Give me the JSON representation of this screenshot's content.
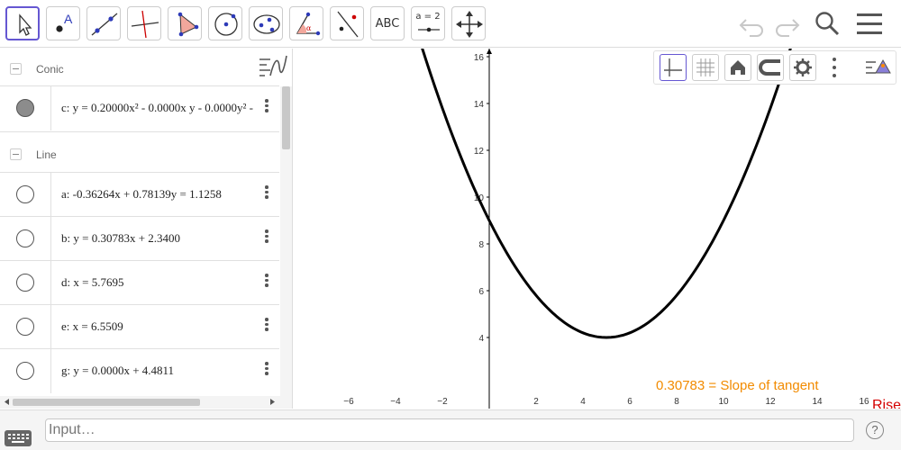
{
  "toolbar": {
    "text_tool_label": "ABC",
    "slider_tool_label": "a = 2",
    "accent": "#6557d2",
    "icons": [
      "move-icon",
      "point-icon",
      "line-icon",
      "perpendicular-icon",
      "polygon-icon",
      "circle-center-icon",
      "conic-icon",
      "angle-icon",
      "reflect-icon",
      "text-icon",
      "slider-icon",
      "move-graphics-icon"
    ]
  },
  "algebra": {
    "groups": [
      {
        "label": "Conic",
        "items": [
          {
            "expr": "c: y = 0.20000x² - 0.0000x y - 0.0000y² -",
            "filled": true
          }
        ]
      },
      {
        "label": "Line",
        "items": [
          {
            "expr": "a: -0.36264x + 0.78139y = 1.1258",
            "filled": false
          },
          {
            "expr": "b: y = 0.30783x + 2.3400",
            "filled": false
          },
          {
            "expr": "d: x = 5.7695",
            "filled": false
          },
          {
            "expr": "e: x = 6.5509",
            "filled": false
          },
          {
            "expr": "g: y = 0.0000x + 4.4811",
            "filled": false
          }
        ]
      }
    ]
  },
  "graphics": {
    "x_ticks": [
      "−6",
      "−4",
      "−2",
      "2",
      "4",
      "6",
      "8",
      "10",
      "12",
      "14",
      "16"
    ],
    "y_ticks": [
      "4",
      "6",
      "8",
      "10",
      "12",
      "14",
      "16"
    ],
    "slope_text": "0.30783 = Slope of tangent",
    "slope_color": "#f28b00",
    "rise_text": "Rise",
    "rise_color": "#d40000",
    "curve_color": "#000000"
  },
  "input": {
    "placeholder": "Input…",
    "help": "?"
  }
}
